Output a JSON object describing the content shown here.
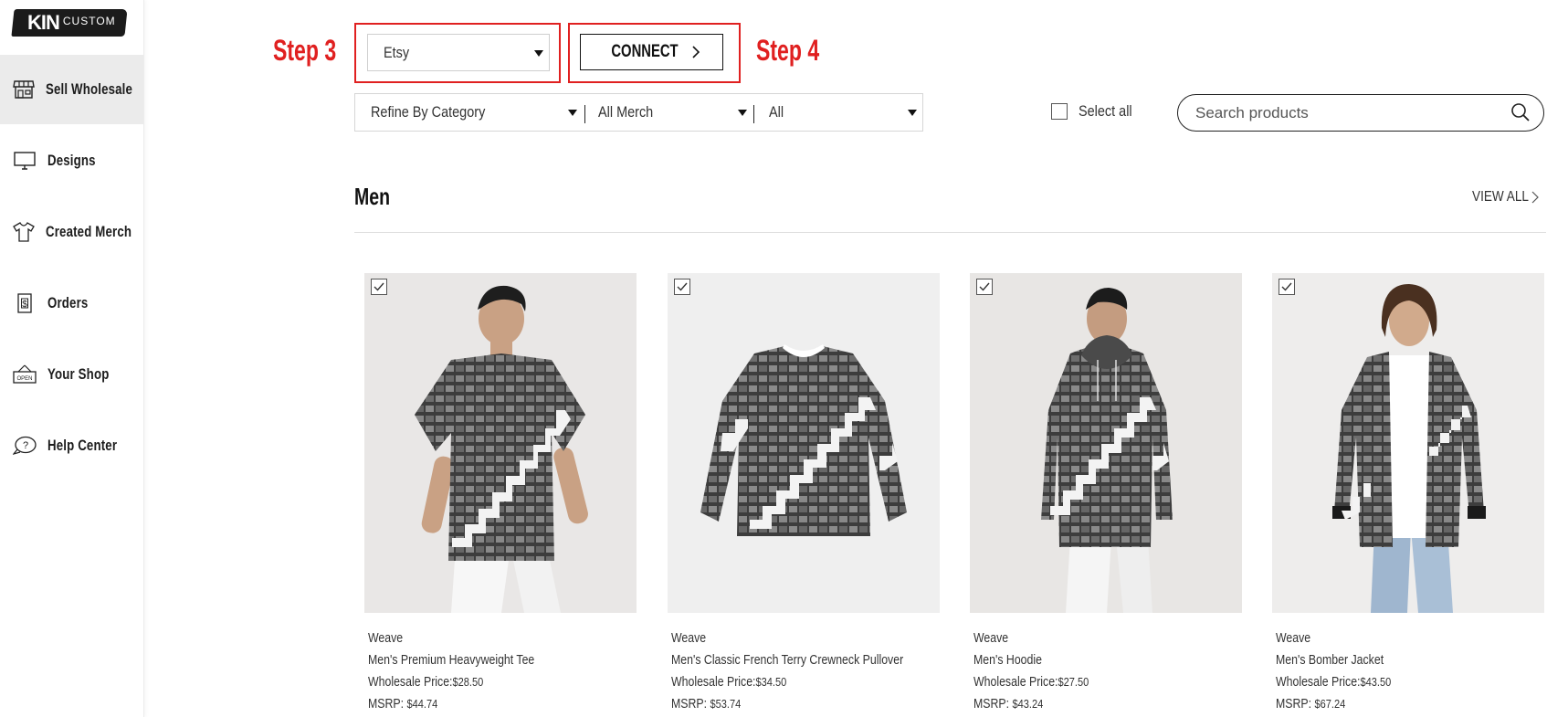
{
  "brand": {
    "kin": "KIN",
    "custom": "CUSTOM"
  },
  "sidebar": {
    "items": [
      {
        "label": "Sell Wholesale",
        "icon": "storefront-icon",
        "active": true
      },
      {
        "label": "Designs",
        "icon": "monitor-icon",
        "active": false
      },
      {
        "label": "Created Merch",
        "icon": "tshirt-icon",
        "active": false
      },
      {
        "label": "Orders",
        "icon": "receipt-icon",
        "active": false
      },
      {
        "label": "Your Shop",
        "icon": "open-sign-icon",
        "active": false
      },
      {
        "label": "Help Center",
        "icon": "help-bubble-icon",
        "active": false
      }
    ]
  },
  "steps": {
    "step3": "Step 3",
    "step4": "Step 4"
  },
  "platform_select": {
    "value": "Etsy"
  },
  "connect_button": {
    "label": "CONNECT"
  },
  "filters": {
    "category": "Refine By Category",
    "merch": "All Merch",
    "all": "All"
  },
  "select_all": {
    "label": "Select all",
    "checked": false
  },
  "search": {
    "placeholder": "Search products"
  },
  "section": {
    "title": "Men",
    "view_all": "VIEW ALL"
  },
  "products": [
    {
      "design": "Weave",
      "name": "Men's Premium Heavyweight Tee",
      "wholesale_label": "Wholesale Price:",
      "wholesale": "$28.50",
      "msrp_label": "MSRP: ",
      "msrp": "$44.74",
      "checked": true,
      "type": "tee"
    },
    {
      "design": "Weave",
      "name": "Men's Classic French Terry Crewneck Pullover",
      "wholesale_label": "Wholesale Price:",
      "wholesale": "$34.50",
      "msrp_label": "MSRP: ",
      "msrp": "$53.74",
      "checked": true,
      "type": "pullover"
    },
    {
      "design": "Weave",
      "name": "Men's Hoodie",
      "wholesale_label": "Wholesale Price:",
      "wholesale": "$27.50",
      "msrp_label": "MSRP: ",
      "msrp": "$43.24",
      "checked": true,
      "type": "hoodie"
    },
    {
      "design": "Weave",
      "name": "Men's Bomber Jacket",
      "wholesale_label": "Wholesale Price:",
      "wholesale": "$43.50",
      "msrp_label": "MSRP: ",
      "msrp": "$67.24",
      "checked": true,
      "type": "bomber"
    }
  ],
  "colors": {
    "accent_red": "#e02020",
    "text": "#333333",
    "sidebar_active": "#ebebeb"
  }
}
